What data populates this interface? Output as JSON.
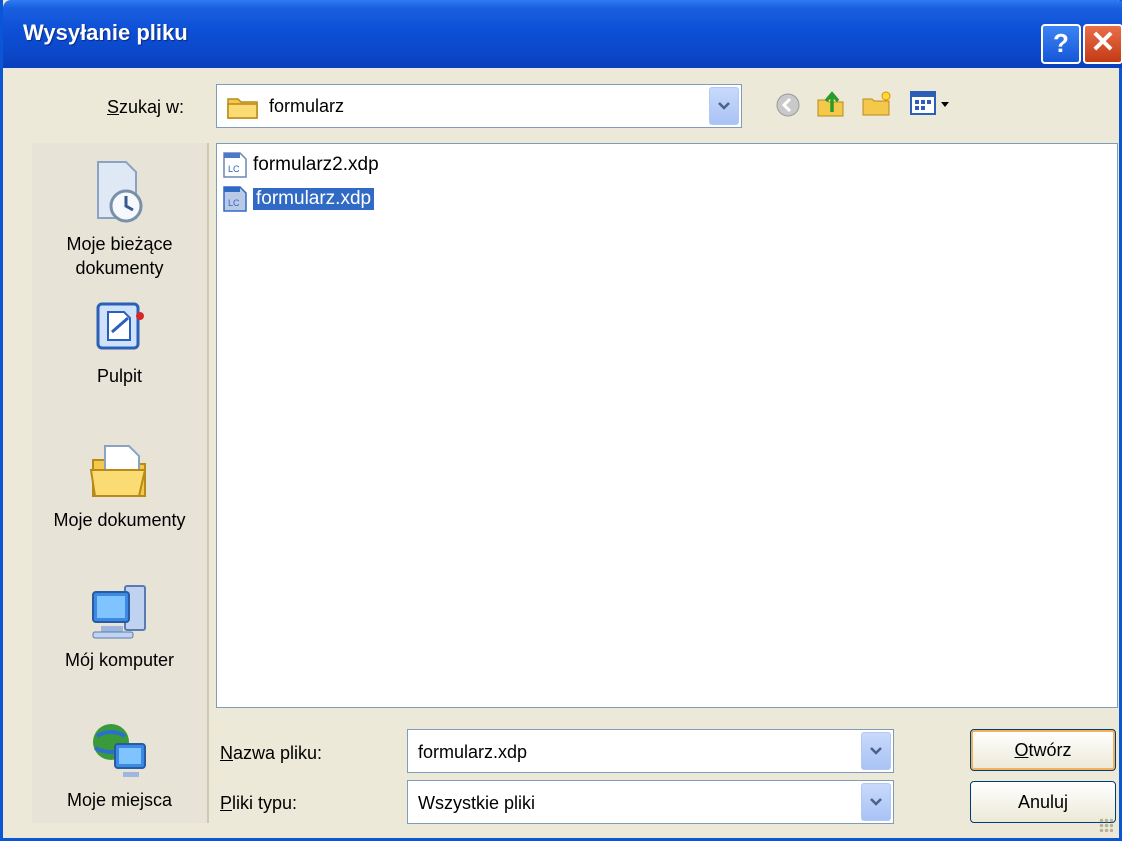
{
  "window": {
    "title": "Wysyłanie pliku",
    "help_button": "?",
    "close_button": "✕"
  },
  "lookin": {
    "label_mnemonic": "S",
    "label_rest": "zukaj w:",
    "value": "formularz"
  },
  "toolbar": {
    "icons": [
      "back-icon",
      "up-folder-icon",
      "new-folder-icon",
      "view-menu-icon"
    ]
  },
  "sidebar": {
    "items": [
      {
        "label_line1": "Moje bieżące",
        "label_line2": "dokumenty",
        "icon": "recent-documents-icon"
      },
      {
        "label_line1": "Pulpit",
        "label_line2": "",
        "icon": "desktop-icon"
      },
      {
        "label_line1": "Moje dokumenty",
        "label_line2": "",
        "icon": "my-documents-icon"
      },
      {
        "label_line1": "Mój komputer",
        "label_line2": "",
        "icon": "my-computer-icon"
      },
      {
        "label_line1": "Moje miejsca",
        "label_line2": "",
        "icon": "network-places-icon"
      }
    ]
  },
  "files": [
    {
      "name": "formularz2.xdp",
      "selected": false,
      "icon": "lc-document-icon"
    },
    {
      "name": "formularz.xdp",
      "selected": true,
      "icon": "lc-document-icon"
    }
  ],
  "filename": {
    "label_mnemonic": "N",
    "label_rest": "azwa pliku:",
    "value": "formularz.xdp"
  },
  "filetype": {
    "label_mnemonic": "P",
    "label_rest": "liki typu:",
    "value": "Wszystkie pliki"
  },
  "buttons": {
    "open_mnemonic": "O",
    "open_rest": "twórz",
    "cancel": "Anuluj"
  },
  "colors": {
    "titlebar": "#0b47c8",
    "selection": "#316ac5",
    "dialog_bg": "#ece9d8"
  }
}
